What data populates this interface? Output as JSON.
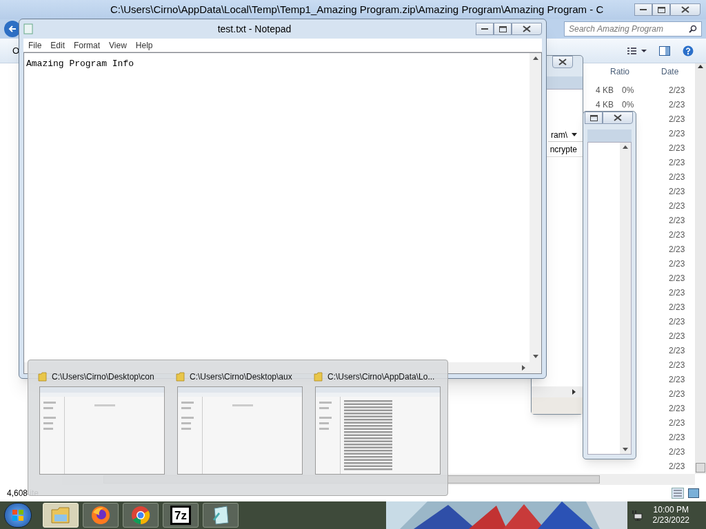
{
  "explorer": {
    "title": "C:\\Users\\Cirno\\AppData\\Local\\Temp\\Temp1_Amazing Program.zip\\Amazing Program\\Amazing Program - C",
    "search": {
      "placeholder": "Search Amazing Program"
    },
    "toolbar_label": "O",
    "columns": [
      "Ratio",
      "Date"
    ],
    "rows": [
      {
        "size": "4 KB",
        "ratio": "0%",
        "date": "2/23"
      },
      {
        "size": "4 KB",
        "ratio": "0%",
        "date": "2/23"
      },
      {
        "date": "2/23"
      },
      {
        "date": "2/23"
      },
      {
        "date": "2/23"
      },
      {
        "date": "2/23"
      },
      {
        "date": "2/23"
      },
      {
        "date": "2/23"
      },
      {
        "date": "2/23"
      },
      {
        "date": "2/23"
      },
      {
        "date": "2/23"
      },
      {
        "date": "2/23"
      },
      {
        "date": "2/23"
      },
      {
        "date": "2/23"
      },
      {
        "date": "2/23"
      },
      {
        "date": "2/23"
      },
      {
        "date": "2/23"
      },
      {
        "date": "2/23"
      },
      {
        "date": "2/23"
      },
      {
        "date": "2/23"
      },
      {
        "date": "2/23"
      },
      {
        "date": "2/23"
      },
      {
        "date": "2/23"
      },
      {
        "date": "2/23"
      },
      {
        "date": "2/23"
      },
      {
        "date": "2/23"
      },
      {
        "date": "2/23"
      }
    ],
    "status": "4,608 ite"
  },
  "back_windows": [
    {
      "kind": "dropdown",
      "address": "ram\\",
      "column": "ncrypte"
    },
    {
      "kind": "plain"
    }
  ],
  "notepad": {
    "title": "test.txt - Notepad",
    "menu": [
      "File",
      "Edit",
      "Format",
      "View",
      "Help"
    ],
    "text": "Amazing Program Info"
  },
  "thumbnails": [
    {
      "title": "C:\\Users\\Cirno\\Desktop\\con",
      "kind": "empty"
    },
    {
      "title": "C:\\Users\\Cirno\\Desktop\\aux",
      "kind": "empty"
    },
    {
      "title": "C:\\Users\\Cirno\\AppData\\Lo...",
      "kind": "list"
    }
  ],
  "taskbar": {
    "buttons": [
      {
        "kind": "explorer",
        "selected": true
      },
      {
        "kind": "firefox",
        "selected": false
      },
      {
        "kind": "chrome",
        "selected": false
      },
      {
        "kind": "sevenzip",
        "label": "7z",
        "selected": false
      },
      {
        "kind": "notepad",
        "selected": false
      }
    ],
    "clock": {
      "time": "10:00 PM",
      "date": "2/23/2022"
    }
  }
}
